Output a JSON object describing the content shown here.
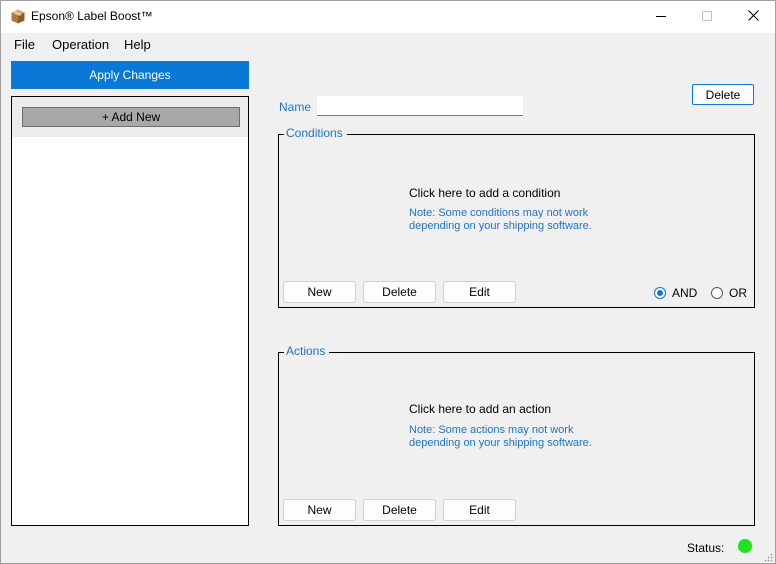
{
  "window": {
    "title": "Epson® Label Boost™"
  },
  "menu": {
    "items": [
      "File",
      "Operation",
      "Help"
    ]
  },
  "sidebar": {
    "apply_label": "Apply Changes",
    "add_new_label": "+ Add New"
  },
  "rule": {
    "name_label": "Name",
    "name_value": "",
    "delete_label": "Delete"
  },
  "conditions": {
    "title": "Conditions",
    "hint": "Click here to add a condition",
    "note_line1": "Note: Some conditions may not work",
    "note_line2": "depending on your shipping software.",
    "buttons": [
      "New",
      "Delete",
      "Edit"
    ],
    "logic_options": [
      "AND",
      "OR"
    ],
    "logic_selected": "AND"
  },
  "actions": {
    "title": "Actions",
    "hint": "Click here to add an action",
    "note_line1": "Note: Some actions may not work",
    "note_line2": "depending on your shipping software.",
    "buttons": [
      "New",
      "Delete",
      "Edit"
    ]
  },
  "status": {
    "label": "Status:",
    "state": "ok",
    "color": "#1ee31e"
  },
  "colors": {
    "accent": "#0a78d7",
    "label_blue": "#1f74c4"
  },
  "icons": {
    "app": "package-box-icon",
    "minimize": "minimize-icon",
    "maximize": "maximize-icon",
    "close": "close-icon",
    "resize": "resize-grip-icon"
  }
}
